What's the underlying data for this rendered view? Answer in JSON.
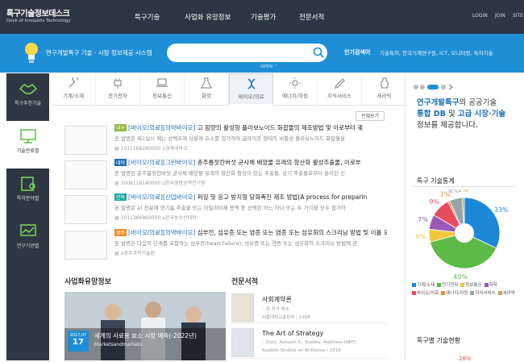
{
  "header": {
    "logo_title": "특구기술정보데스크",
    "logo_sub": "Desk of Innopolis Technology",
    "nav": [
      "특구기술",
      "사업화 유망정보",
      "기술평가",
      "전문서적"
    ],
    "util": [
      "LOGIN",
      "JOIN",
      "SITE"
    ]
  },
  "search": {
    "banner_text": "연구개발특구 기술 · 시장 정보제공 시스템",
    "placeholder": "",
    "open_label": "OPEN",
    "hot_label": "인기검색어",
    "hot_keywords": "기술특허, 한국기계연구원, ICT, 모니터링, 특허기술"
  },
  "sidebar": [
    {
      "label": "특구추천기술",
      "icon": "handshake-icon"
    },
    {
      "label": "기술분류별",
      "icon": "monitor-icon"
    },
    {
      "label": "특허분야별",
      "icon": "book-gear-icon"
    },
    {
      "label": "연구기관별",
      "icon": "chart-monitor-icon"
    }
  ],
  "tabs": [
    {
      "label": "기계/소재",
      "icon": "wrench-icon"
    },
    {
      "label": "전기전자",
      "icon": "plug-icon"
    },
    {
      "label": "정보통신",
      "icon": "laptop-icon"
    },
    {
      "label": "화학",
      "icon": "flask-icon"
    },
    {
      "label": "바이오/의료",
      "icon": "dna-icon"
    },
    {
      "label": "에너지/자원",
      "icon": "sun-icon"
    },
    {
      "label": "지식서비스",
      "icon": "pen-icon"
    },
    {
      "label": "세라믹",
      "icon": "vase-icon"
    }
  ],
  "more_label": "전체보기",
  "entries": [
    {
      "badge": "대구",
      "badge_color": "#8fbc3f",
      "category": "[바이오/의료]",
      "sub": "[의약바이오]",
      "title": "고 함량의 활성형 플라보노이드 화합물의 제조방법 및 이로부터 궤",
      "desc": "본 발명은 제1실시 예는 상백초에 당분해 효소를 첨가하여 글라이콘 형태의 비활성 플라보노이드 화합물을",
      "num": "1011168280000",
      "org": "경북대학교"
    },
    {
      "badge": "대덕",
      "badge_color": "#1e6fb8",
      "category": "[바이오/의료]",
      "sub": "[그린바이오]",
      "title": "층주름잣칸버섯 균사체 배양물 유래의 항산화 활성추출물, 이로부",
      "desc": "본 발명은 층주름잣칸버섯 균사체 배양물 유래의 항산화 활성이 있는 추출물, 상기 추출물로부터 분리된 신",
      "num": "1008116140000",
      "org": "한국생명공학연구원"
    },
    {
      "badge": "전북",
      "badge_color": "#21a7a0",
      "category": "[바이오/의료]",
      "sub": "[산업바이오]",
      "title": "퍼징 및 응고 방지형 당화촉진 제조 방법(A process for preparin",
      "desc": "본 발명은 a) 전분에 엿기름 추출물 또는 아밀라아제 용액 중 선택된 어느 하나 또는 두 가지을 모두 첨가하",
      "num": "1011386860000",
      "org": "한국농수산대학"
    },
    {
      "badge": "광주",
      "badge_color": "#f08c2a",
      "category": "[바이오/의료]",
      "sub": "[의약바이오]",
      "title": "심부전, 섬유증 또는 염증 또는 염증 또는 섬유화의 스크리닝 방법 및 이를 포함하",
      "desc": "본 발명은 다음의 단계를 포함하는 심부전(heart failure), 섬유증 또는 염증 또는 섬유화의 스크리닝 방법에 관",
      "num": "",
      "org": "광주과학기술원"
    }
  ],
  "biz": {
    "section_title": "사업화유망정보",
    "date_year": "2017.07",
    "date_day": "17",
    "title": "세계의 사료용 효소 시장 예측(-2022년)",
    "source": "Marketsandmarkets"
  },
  "books": {
    "section_title": "전문서적",
    "items": [
      {
        "title": "사회계약론",
        "author": "장 자크 루소",
        "publisher": "서울대학교출판부 / 1999"
      },
      {
        "title": "The Art of Strategy",
        "author": "Dixit, Avinash K., Dudley, Matthew (NRT)",
        "publisher": "Audible Studios on Brilliance / 2016"
      }
    ]
  },
  "promo": {
    "line1a": "연구개발특구",
    "line1b": "의 공공기술",
    "line2a": "통합 DB",
    "line2b": " 및 ",
    "line2c": "고급 시장·기술",
    "line3": "정보를 제공합니다."
  },
  "stats_title": "특구 기술통계",
  "stats2_title": "특구별 기술현황",
  "stats2_pct_label": "28%",
  "chart_data": {
    "type": "pie",
    "title": "특구 기술통계",
    "series": [
      {
        "name": "기계/소재",
        "value": 33,
        "color": "#1e88d8"
      },
      {
        "name": "전기전자",
        "value": 40,
        "color": "#5cba47"
      },
      {
        "name": "정보통신",
        "value": 6,
        "color": "#f0c63c"
      },
      {
        "name": "화학",
        "value": 7,
        "color": "#9b59b6"
      },
      {
        "name": "바이오/의료",
        "value": 9,
        "color": "#e74c5c"
      },
      {
        "name": "에너지/자원",
        "value": 1,
        "color": "#ef8a2a"
      },
      {
        "name": "지식서비스",
        "value": 6,
        "color": "#95a5b0"
      },
      {
        "name": "세라믹",
        "value": 1,
        "color": "#c7a25a"
      }
    ],
    "labels": [
      "33%",
      "40%",
      "6%",
      "7%",
      "9%",
      "1%",
      "6%",
      "1%"
    ]
  }
}
